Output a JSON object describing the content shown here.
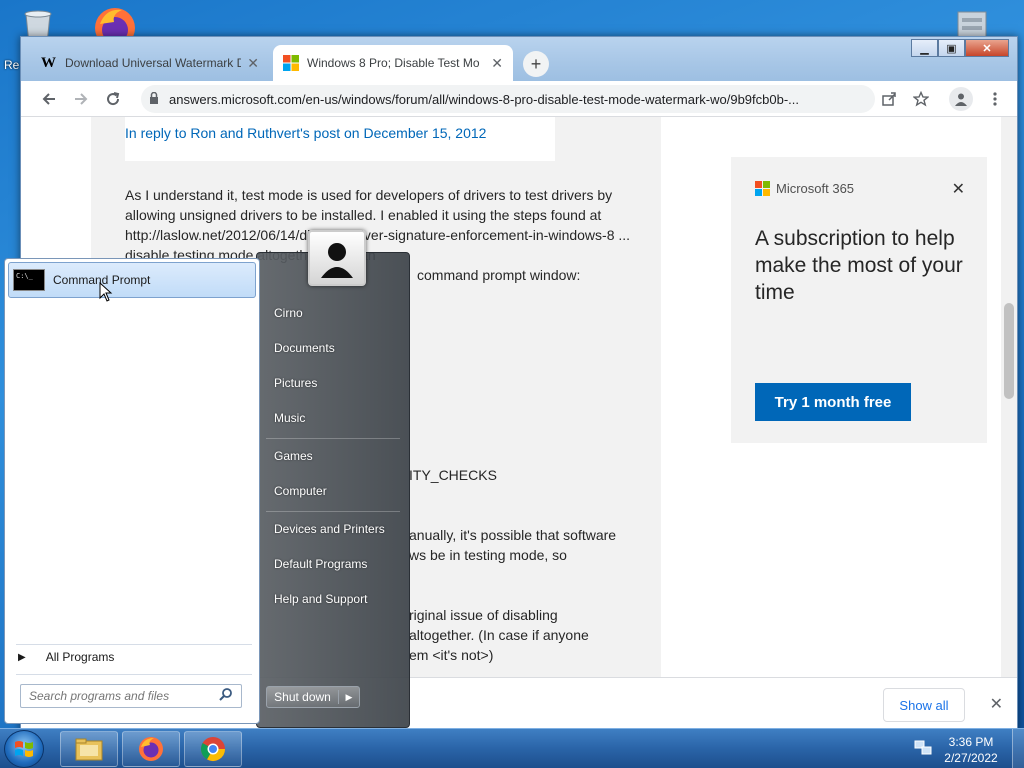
{
  "desktop": {
    "recycle_label": "Re"
  },
  "browser": {
    "tabs": [
      {
        "label": "Download Universal Watermark D",
        "favicon": "W"
      },
      {
        "label": "Windows 8 Pro; Disable Test Mo"
      }
    ],
    "url": "answers.microsoft.com/en-us/windows/forum/all/windows-8-pro-disable-test-mode-watermark-wo/9b9fcb0b-..."
  },
  "article": {
    "reply_link": "In reply to Ron and Ruthvert's post on December 15, 2012",
    "paragraph1": "As I understand it, test mode is used for developers of drivers to test drivers by allowing unsigned drivers to be installed. I enabled it using the steps found at http://laslow.net/2012/06/14/disable-driver-signature-enforcement-in-windows-8 ... disable testing mode altogether, you can",
    "fragments": [
      "command prompt window:",
      "ITY_CHECKS",
      "anually, it's possible that software",
      "ws be in testing mode, so",
      "riginal issue of disabling",
      "altogether. (In case if anyone",
      "em <it's not>)"
    ]
  },
  "ad": {
    "brand": "Microsoft 365",
    "headline": "A subscription to help make the most of your time",
    "cta": "Try 1 month free",
    "colors": [
      "#f25022",
      "#7fba00",
      "#00a4ef",
      "#ffb900"
    ]
  },
  "download_bar": {
    "show_all": "Show all"
  },
  "start_menu": {
    "pinned": "Command Prompt",
    "all_programs": "All Programs",
    "search_placeholder": "Search programs and files",
    "links": [
      "Cirno",
      "Documents",
      "Pictures",
      "Music",
      "Games",
      "Computer",
      "Devices and Printers",
      "Default Programs",
      "Help and Support"
    ],
    "shutdown": "Shut down"
  },
  "taskbar": {
    "time": "3:36 PM",
    "date": "2/27/2022"
  }
}
